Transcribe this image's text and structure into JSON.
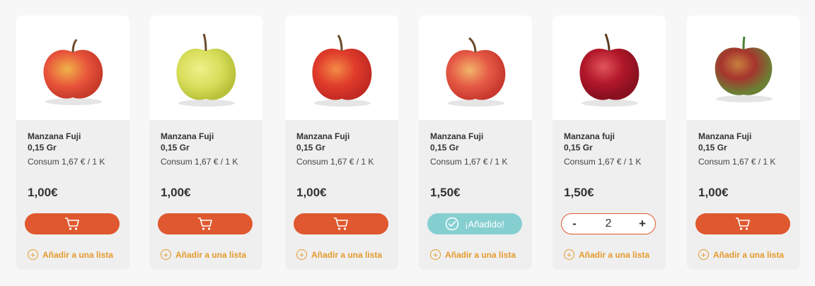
{
  "products": [
    {
      "name": "Manzana Fuji",
      "weight": "0,15 Gr",
      "unit_price": "Consum 1,67 € / 1 K",
      "price": "1,00€",
      "state": "cart",
      "apple": {
        "top": "#e8533a",
        "bottom": "#f0b34a",
        "stem": "#6a4a2a"
      },
      "add_to_list": "Añadir a una lista"
    },
    {
      "name": "Manzana Fuji",
      "weight": "0,15 Gr",
      "unit_price": "Consum 1,67 € / 1 K",
      "price": "1,00€",
      "state": "cart",
      "apple": {
        "top": "#d8de5b",
        "bottom": "#c7d043",
        "stem": "#6a4a2a"
      },
      "add_to_list": "Añadir a una lista"
    },
    {
      "name": "Manzana Fuji",
      "weight": "0,15 Gr",
      "unit_price": "Consum 1,67 € / 1 K",
      "price": "1,00€",
      "state": "cart",
      "apple": {
        "top": "#e03c2b",
        "bottom": "#f38b47",
        "stem": "#6a4a2a"
      },
      "add_to_list": "Añadir a una lista"
    },
    {
      "name": "Manzana Fuji",
      "weight": "0,15 Gr",
      "unit_price": "Consum 1,67 € / 1 K",
      "price": "1,50€",
      "state": "added",
      "added_label": "¡Añadido!",
      "apple": {
        "top": "#e55a45",
        "bottom": "#f2b56b",
        "stem": "#6a4a2a"
      },
      "add_to_list": "Añadir a una lista"
    },
    {
      "name": "Manzana fuji",
      "weight": "0,15 Gr",
      "unit_price": "Consum 1,67 € / 1 K",
      "price": "1,50€",
      "state": "stepper",
      "quantity": "2",
      "minus": "-",
      "plus": "+",
      "apple": {
        "top": "#b2182a",
        "bottom": "#d43b3e",
        "stem": "#5a3a20"
      },
      "add_to_list": "Añadir a una lista"
    },
    {
      "name": "Manzana Fuji",
      "weight": "0,15 Gr",
      "unit_price": "Consum 1,67 € / 1 K",
      "price": "1,00€",
      "state": "cart",
      "apple": {
        "top": "#a6352e",
        "bottom": "#7f8a3a",
        "stem": "#4e7f33"
      },
      "add_to_list": "Añadir a una lista"
    }
  ],
  "colors": {
    "accent": "#e0582f",
    "added": "#86cfd1",
    "link": "#e59a2c"
  }
}
